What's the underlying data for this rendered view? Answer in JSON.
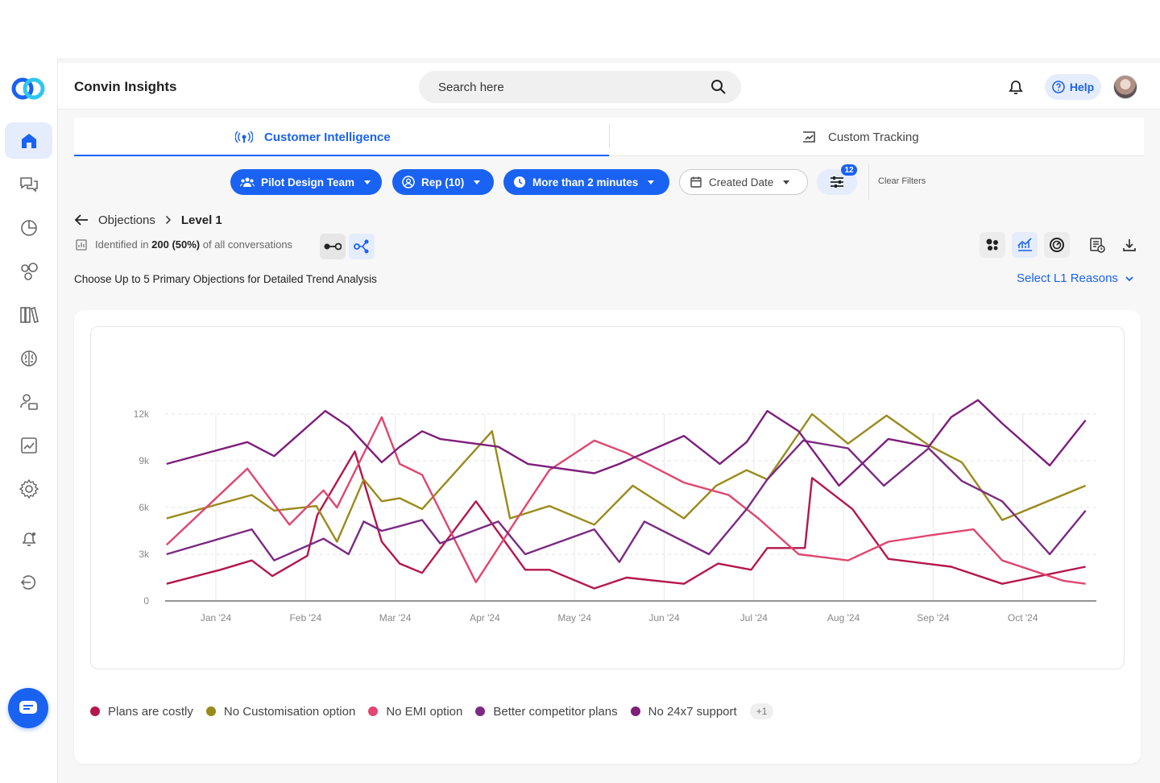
{
  "header": {
    "title": "Convin Insights",
    "search_placeholder": "Search here",
    "help_label": "Help"
  },
  "tabs": [
    {
      "label": "Customer Intelligence",
      "active": true
    },
    {
      "label": "Custom Tracking",
      "active": false
    }
  ],
  "filters": {
    "team": "Pilot Design Team",
    "rep": "Rep (10)",
    "duration": "More than 2 minutes",
    "date": "Created Date",
    "advanced_count": "12",
    "clear": "Clear Filters"
  },
  "breadcrumb": {
    "parent": "Objections",
    "current": "Level 1"
  },
  "identified": {
    "prefix": "Identified in",
    "count": "200",
    "pct": "(50%)",
    "suffix": "of all conversations"
  },
  "choose_text": "Choose Up to 5 Primary Objections for Detailed Trend Analysis",
  "select_l1": "Select L1 Reasons",
  "legend_more": "+1",
  "colors": {
    "accent": "#1a62f2"
  },
  "chart_data": {
    "type": "line",
    "x_labels": [
      "Jan '24",
      "Feb '24",
      "Mar '24",
      "Apr '24",
      "May '24",
      "Jun '24",
      "Jul '24",
      "Aug '24",
      "Sep '24",
      "Oct '24"
    ],
    "y_ticks": [
      "0",
      "3k",
      "6k",
      "9k",
      "12k"
    ],
    "ylim": [
      0,
      12000
    ],
    "grid": true,
    "legend": "bottom-left",
    "series": [
      {
        "name": "Plans are costly",
        "color": "#b5174b",
        "points": [
          [
            -0.55,
            1100
          ],
          [
            0.05,
            2000
          ],
          [
            0.4,
            2600
          ],
          [
            0.63,
            1600
          ],
          [
            1.02,
            2900
          ],
          [
            1.13,
            5500
          ],
          [
            1.55,
            9600
          ],
          [
            1.85,
            3800
          ],
          [
            2.05,
            2400
          ],
          [
            2.3,
            1800
          ],
          [
            2.9,
            6400
          ],
          [
            3.45,
            2000
          ],
          [
            3.72,
            2000
          ],
          [
            4.22,
            800
          ],
          [
            4.58,
            1500
          ],
          [
            5.22,
            1100
          ],
          [
            5.6,
            2400
          ],
          [
            5.97,
            2000
          ],
          [
            6.15,
            3400
          ],
          [
            6.57,
            3400
          ],
          [
            6.65,
            7900
          ],
          [
            7.1,
            5900
          ],
          [
            7.5,
            2700
          ],
          [
            8.2,
            2200
          ],
          [
            8.77,
            1100
          ],
          [
            9.7,
            2200
          ]
        ]
      },
      {
        "name": "No Customisation option",
        "color": "#9a8a1c",
        "points": [
          [
            -0.55,
            5300
          ],
          [
            0.4,
            6800
          ],
          [
            0.65,
            5800
          ],
          [
            1.12,
            6100
          ],
          [
            1.35,
            3800
          ],
          [
            1.65,
            7800
          ],
          [
            1.85,
            6400
          ],
          [
            2.05,
            6600
          ],
          [
            2.3,
            5900
          ],
          [
            3.08,
            10900
          ],
          [
            3.28,
            5300
          ],
          [
            3.72,
            6100
          ],
          [
            4.22,
            4900
          ],
          [
            4.65,
            7400
          ],
          [
            5.22,
            5300
          ],
          [
            5.58,
            7400
          ],
          [
            5.92,
            8400
          ],
          [
            6.15,
            7800
          ],
          [
            6.65,
            12000
          ],
          [
            7.05,
            10100
          ],
          [
            7.48,
            11900
          ],
          [
            7.95,
            10000
          ],
          [
            8.32,
            8900
          ],
          [
            8.77,
            5200
          ],
          [
            9.7,
            7400
          ]
        ]
      },
      {
        "name": "No EMI option",
        "color": "#e0466e",
        "points": [
          [
            -0.55,
            3600
          ],
          [
            0.35,
            8500
          ],
          [
            0.82,
            4900
          ],
          [
            1.2,
            7100
          ],
          [
            1.35,
            6000
          ],
          [
            1.85,
            11800
          ],
          [
            2.05,
            8800
          ],
          [
            2.3,
            8100
          ],
          [
            2.9,
            1200
          ],
          [
            3.35,
            5200
          ],
          [
            3.72,
            8400
          ],
          [
            4.22,
            10300
          ],
          [
            4.58,
            9500
          ],
          [
            5.22,
            7600
          ],
          [
            5.72,
            6800
          ],
          [
            6.05,
            5300
          ],
          [
            6.5,
            3000
          ],
          [
            7.05,
            2600
          ],
          [
            7.5,
            3800
          ],
          [
            7.95,
            4200
          ],
          [
            8.45,
            4600
          ],
          [
            8.77,
            2600
          ],
          [
            9.45,
            1300
          ],
          [
            9.7,
            1100
          ]
        ]
      },
      {
        "name": "Better competitor plans",
        "color": "#7b2a82",
        "points": [
          [
            -0.55,
            3000
          ],
          [
            0.4,
            4600
          ],
          [
            0.65,
            2600
          ],
          [
            1.2,
            4000
          ],
          [
            1.48,
            3000
          ],
          [
            1.65,
            5100
          ],
          [
            1.85,
            4500
          ],
          [
            2.05,
            4800
          ],
          [
            2.3,
            5200
          ],
          [
            2.5,
            3700
          ],
          [
            3.15,
            5100
          ],
          [
            3.45,
            3000
          ],
          [
            4.22,
            4600
          ],
          [
            4.5,
            2500
          ],
          [
            4.78,
            5100
          ],
          [
            5.5,
            3000
          ],
          [
            5.92,
            5900
          ],
          [
            6.15,
            7800
          ],
          [
            6.55,
            10300
          ],
          [
            7.05,
            9800
          ],
          [
            7.45,
            7400
          ],
          [
            7.95,
            9800
          ],
          [
            8.32,
            7700
          ],
          [
            8.77,
            6400
          ],
          [
            9.3,
            3000
          ],
          [
            9.7,
            5800
          ]
        ]
      },
      {
        "name": "No 24x7 support",
        "color": "#7e1e7b",
        "points": [
          [
            -0.55,
            8800
          ],
          [
            0.35,
            10200
          ],
          [
            0.65,
            9300
          ],
          [
            1.22,
            12200
          ],
          [
            1.48,
            11200
          ],
          [
            1.85,
            8900
          ],
          [
            2.05,
            9900
          ],
          [
            2.3,
            10900
          ],
          [
            2.5,
            10400
          ],
          [
            3.15,
            9900
          ],
          [
            3.48,
            8800
          ],
          [
            4.22,
            8200
          ],
          [
            4.5,
            8800
          ],
          [
            5.22,
            10600
          ],
          [
            5.62,
            8800
          ],
          [
            5.92,
            10200
          ],
          [
            6.15,
            12200
          ],
          [
            6.5,
            10900
          ],
          [
            6.95,
            7400
          ],
          [
            7.5,
            10400
          ],
          [
            7.95,
            9900
          ],
          [
            8.2,
            11800
          ],
          [
            8.5,
            12900
          ],
          [
            8.77,
            11400
          ],
          [
            9.3,
            8700
          ],
          [
            9.7,
            11600
          ]
        ]
      }
    ]
  }
}
